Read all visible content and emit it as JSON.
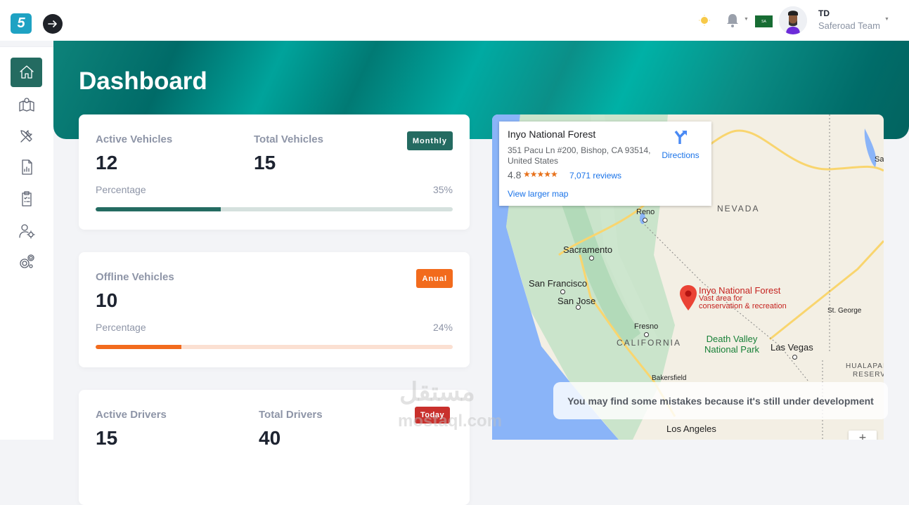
{
  "header": {
    "logo_letter": "5",
    "user": {
      "initials": "TD",
      "team": "Saferoad Team"
    },
    "flag_text": "SA"
  },
  "sidebar": {
    "items": [
      {
        "name": "home",
        "icon": "home-icon",
        "active": true
      },
      {
        "name": "map",
        "icon": "map-icon",
        "active": false
      },
      {
        "name": "maintenance",
        "icon": "tools-icon",
        "active": false
      },
      {
        "name": "reports",
        "icon": "report-icon",
        "active": false
      },
      {
        "name": "tasks",
        "icon": "clipboard-icon",
        "active": false
      },
      {
        "name": "user-settings",
        "icon": "user-gear-icon",
        "active": false
      },
      {
        "name": "settings",
        "icon": "gears-icon",
        "active": false
      }
    ]
  },
  "page": {
    "title": "Dashboard"
  },
  "cards": [
    {
      "label_a": "Active Vehicles",
      "value_a": "12",
      "label_b": "Total Vehicles",
      "value_b": "15",
      "badge": "Monthly",
      "badge_color": "#246b61",
      "pct_label": "Percentage",
      "pct_text": "35%",
      "pct": 35,
      "bar_color": "#246b61",
      "track_color": "#d5e1de"
    },
    {
      "label_a": "Offline Vehicles",
      "value_a": "10",
      "badge": "Anual",
      "badge_color": "#f26b1d",
      "pct_label": "Percentage",
      "pct_text": "24%",
      "pct": 24,
      "bar_color": "#f26b1d",
      "track_color": "#fbe0d2"
    },
    {
      "label_a": "Active Drivers",
      "value_a": "15",
      "label_b": "Total Drivers",
      "value_b": "40",
      "badge": "Today",
      "badge_color": "#c9302c"
    }
  ],
  "map": {
    "place": {
      "name": "Inyo National Forest",
      "address": "351 Pacu Ln #200, Bishop, CA 93514, United States",
      "rating": "4.8",
      "stars": "★★★★★",
      "reviews": "7,071 reviews",
      "directions": "Directions",
      "larger_map": "View larger map"
    },
    "pin": {
      "title": "Inyo National Forest",
      "subtitle_1": "Vast area for",
      "subtitle_2": "conservation & recreation"
    },
    "labels": {
      "reno": "Reno",
      "sacramento": "Sacramento",
      "san_francisco": "San Francisco",
      "san_jose": "San Jose",
      "fresno": "Fresno",
      "bakersfield": "Bakersfield",
      "los_angeles": "Los Angeles",
      "las_vegas": "Las Vegas",
      "st_george": "St. George",
      "salt": "Sa",
      "nevada": "NEVADA",
      "california": "CALIFORNIA",
      "park_1": "Death Valley",
      "park_2": "National Park",
      "hualapai_1": "HUALAPAI INDIAN",
      "hualapai_2": "RESERVATION"
    },
    "zoom_in": "+"
  },
  "toast": {
    "text": "You may find some mistakes because it's still under development"
  },
  "watermark": {
    "arabic": "مستقل",
    "latin": "mostaql.com"
  }
}
